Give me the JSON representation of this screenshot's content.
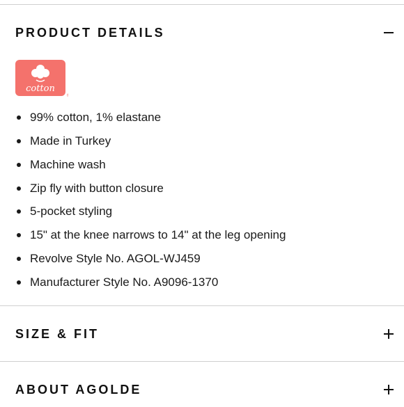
{
  "sections": [
    {
      "title": "PRODUCT DETAILS",
      "expanded": true,
      "icon": "minus-icon"
    },
    {
      "title": "SIZE & FIT",
      "expanded": false,
      "icon": "plus-icon"
    },
    {
      "title": "ABOUT AGOLDE",
      "expanded": false,
      "icon": "plus-icon"
    }
  ],
  "product_details": {
    "badge": {
      "text": "cotton",
      "registered": "®",
      "color": "#f4726c",
      "icon": "cotton-boll-icon"
    },
    "bullets": [
      "99% cotton, 1% elastane",
      "Made in Turkey",
      "Machine wash",
      "Zip fly with button closure",
      "5-pocket styling",
      "15\" at the knee narrows to 14\" at the leg opening",
      "Revolve Style No. AGOL-WJ459",
      "Manufacturer Style No. A9096-1370"
    ]
  },
  "colors": {
    "divider": "#cfcfcf",
    "text": "#1a1a1a",
    "badge": "#f4726c"
  }
}
